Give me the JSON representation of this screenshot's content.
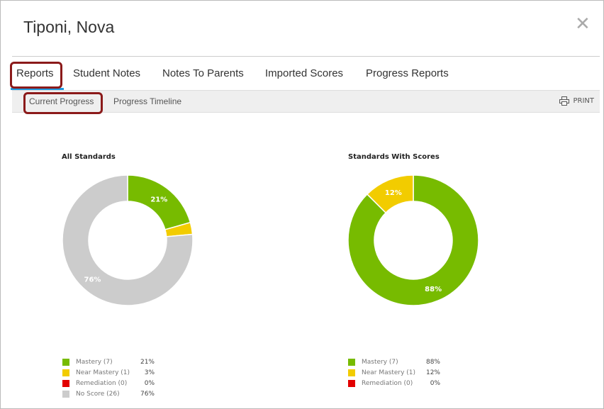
{
  "modal": {
    "title": "Tiponi, Nova",
    "close_icon": "close-icon"
  },
  "tabs": [
    {
      "label": "Reports",
      "active": true
    },
    {
      "label": "Student Notes"
    },
    {
      "label": "Notes To Parents"
    },
    {
      "label": "Imported Scores"
    },
    {
      "label": "Progress Reports"
    }
  ],
  "subtabs": [
    {
      "label": "Current Progress",
      "active": true
    },
    {
      "label": "Progress Timeline"
    }
  ],
  "print_label": "PRINT",
  "colors": {
    "mastery": "#77bb00",
    "near": "#f2cc00",
    "remediation": "#e20000",
    "noscore": "#cccccc",
    "tab_accent": "#1f9ae0",
    "highlight": "#8b1a1a"
  },
  "chart_data": [
    {
      "type": "pie",
      "donut": true,
      "title": "All Standards",
      "slices": [
        {
          "name": "Mastery (7)",
          "value": 7,
          "pct": "21%",
          "color": "#77bb00",
          "label": "21%"
        },
        {
          "name": "Near Mastery (1)",
          "value": 1,
          "pct": "3%",
          "color": "#f2cc00",
          "label": ""
        },
        {
          "name": "Remediation (0)",
          "value": 0,
          "pct": "0%",
          "color": "#e20000",
          "label": ""
        },
        {
          "name": "No Score (26)",
          "value": 26,
          "pct": "76%",
          "color": "#cccccc",
          "label": "76%"
        }
      ]
    },
    {
      "type": "pie",
      "donut": true,
      "title": "Standards With Scores",
      "slices": [
        {
          "name": "Mastery (7)",
          "value": 7,
          "pct": "88%",
          "color": "#77bb00",
          "label": "88%"
        },
        {
          "name": "Near Mastery (1)",
          "value": 1,
          "pct": "12%",
          "color": "#f2cc00",
          "label": "12%"
        },
        {
          "name": "Remediation (0)",
          "value": 0,
          "pct": "0%",
          "color": "#e20000",
          "label": ""
        }
      ]
    }
  ]
}
